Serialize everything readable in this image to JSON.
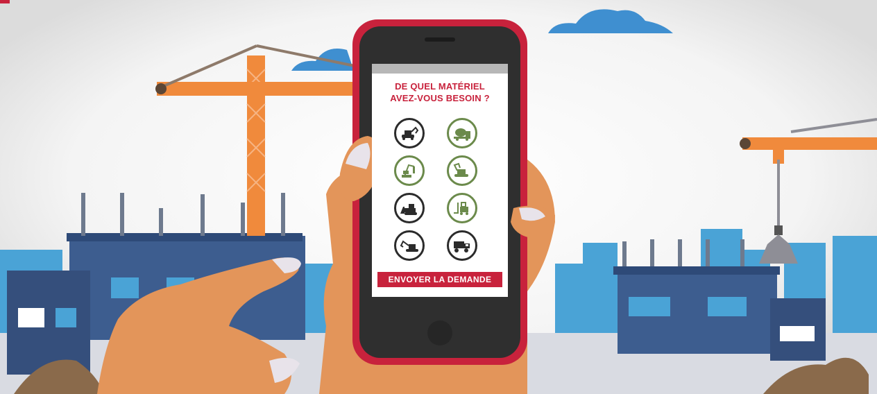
{
  "app": {
    "question_line1": "DE QUEL MATÉRIEL",
    "question_line2": "AVEZ-VOUS BESOIN ?",
    "send_label": "ENVOYER LA DEMANDE"
  },
  "equipment": [
    {
      "icon": "mini-excavator-icon",
      "style": "dark"
    },
    {
      "icon": "concrete-mixer-icon",
      "style": "green"
    },
    {
      "icon": "drilling-rig-icon",
      "style": "green"
    },
    {
      "icon": "excavator-icon",
      "style": "green"
    },
    {
      "icon": "bulldozer-icon",
      "style": "dark"
    },
    {
      "icon": "forklift-icon",
      "style": "green"
    },
    {
      "icon": "crawler-excavator-icon",
      "style": "dark"
    },
    {
      "icon": "dump-truck-icon",
      "style": "dark"
    }
  ],
  "colors": {
    "accent": "#c8223c",
    "dark_icon": "#2b2b2b",
    "green_icon": "#6b8a4b",
    "crane": "#f08a3c",
    "building": "#3d5d8f",
    "sky_building": "#4aa3d6"
  }
}
